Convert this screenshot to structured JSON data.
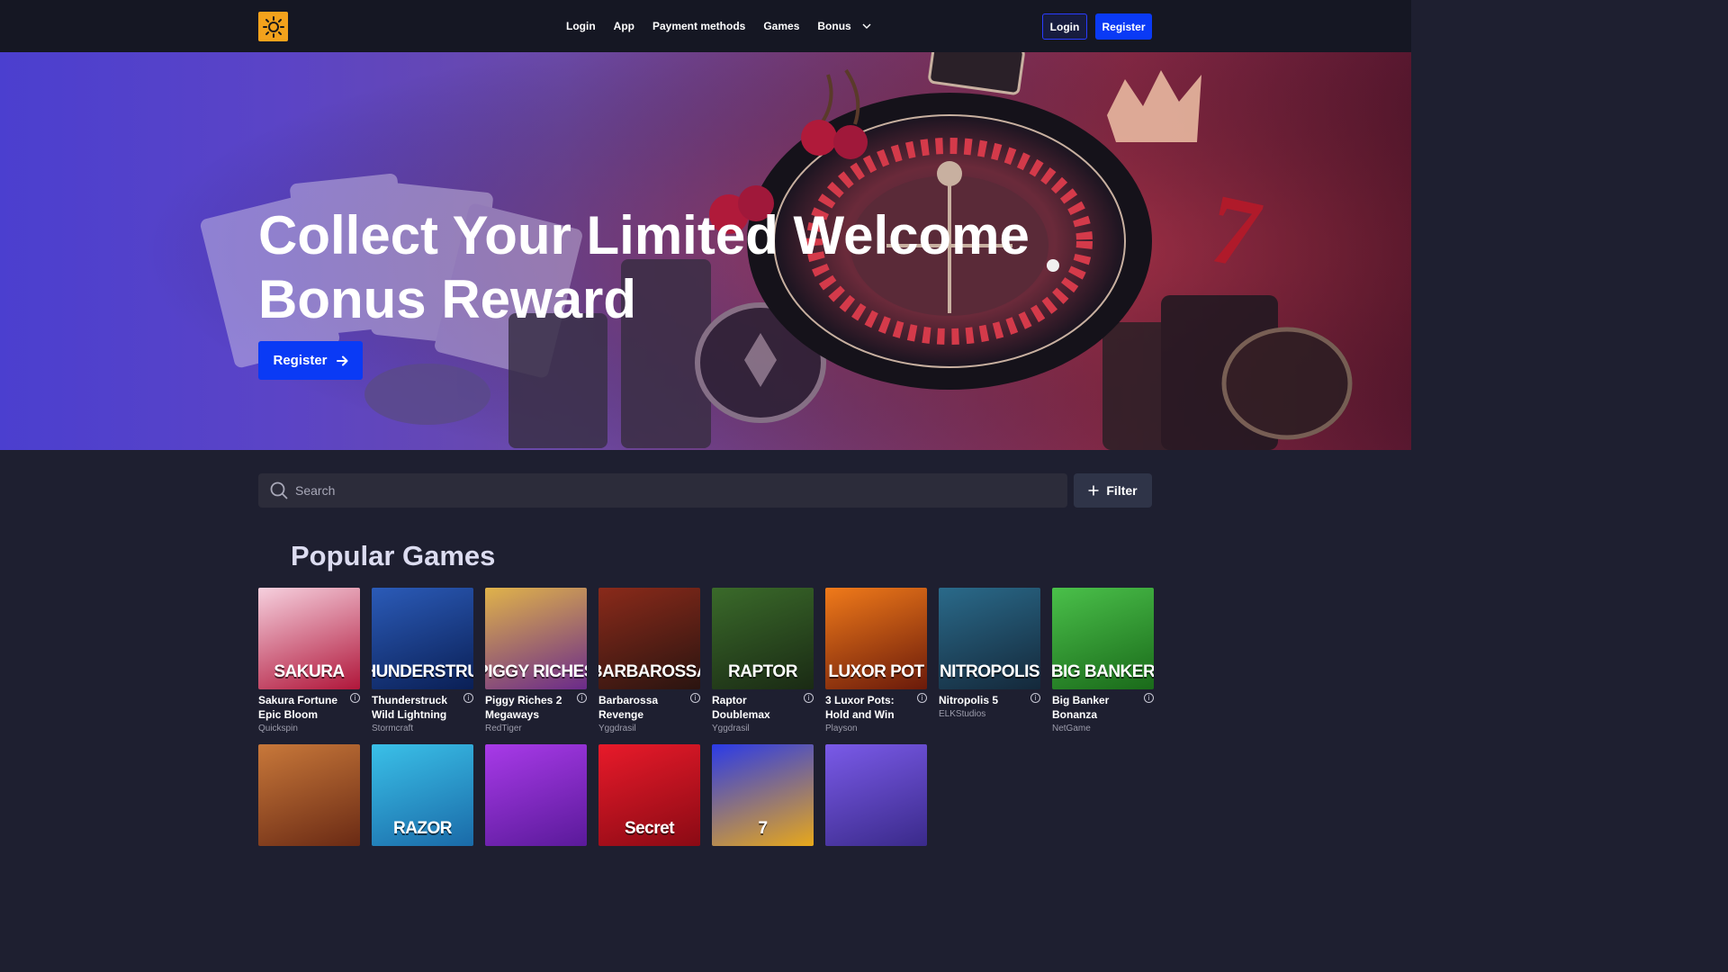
{
  "header": {
    "nav": [
      "Login",
      "App",
      "Payment methods",
      "Games",
      "Bonus"
    ],
    "login_label": "Login",
    "register_label": "Register"
  },
  "hero": {
    "title": "Collect Your Limited Welcome Bonus Reward",
    "cta_label": "Register",
    "cta_icon": "arrow-right-icon"
  },
  "search": {
    "placeholder": "Search",
    "value": ""
  },
  "filter": {
    "label": "Filter",
    "icon": "plus-icon"
  },
  "section_title": "Popular Games",
  "games": [
    {
      "name": "Sakura Fortune Epic Bloom",
      "provider": "Quickspin",
      "art": "SAKURA",
      "c1": "#f6d0de",
      "c2": "#b0163a"
    },
    {
      "name": "Thunderstruck Wild Lightning",
      "provider": "Stormcraft",
      "art": "THUNDERSTRUC",
      "c1": "#2b5bb8",
      "c2": "#0a1f55"
    },
    {
      "name": "Piggy Riches 2 Megaways",
      "provider": "RedTiger",
      "art": "PIGGY RICHES",
      "c1": "#e0b34a",
      "c2": "#6a2a8a"
    },
    {
      "name": "Barbarossa Revenge",
      "provider": "Yggdrasil",
      "art": "BARBAROSSA",
      "c1": "#8a2a1a",
      "c2": "#2a1410"
    },
    {
      "name": "Raptor Doublemax",
      "provider": "Yggdrasil",
      "art": "RAPTOR",
      "c1": "#3a6a2a",
      "c2": "#1a2a14"
    },
    {
      "name": "3 Luxor Pots: Hold and Win",
      "provider": "Playson",
      "art": "LUXOR POT",
      "c1": "#f07a1a",
      "c2": "#6a1a0a"
    },
    {
      "name": "Nitropolis 5",
      "provider": "ELKStudios",
      "art": "NITROPOLIS",
      "c1": "#2a6a8a",
      "c2": "#14283a"
    },
    {
      "name": "Big Banker Bonanza",
      "provider": "NetGame",
      "art": "BIG BANKER",
      "c1": "#4ac04a",
      "c2": "#1a6a1a"
    },
    {
      "name": "",
      "provider": "",
      "art": "",
      "c1": "#c8783a",
      "c2": "#6a2a14"
    },
    {
      "name": "",
      "provider": "",
      "art": "RAZOR",
      "c1": "#3ac0e8",
      "c2": "#1a6aa8"
    },
    {
      "name": "",
      "provider": "",
      "art": "",
      "c1": "#a83ae8",
      "c2": "#5a1a9a"
    },
    {
      "name": "",
      "provider": "",
      "art": "Secret",
      "c1": "#e81a2a",
      "c2": "#8a0a14"
    },
    {
      "name": "",
      "provider": "",
      "art": "7",
      "c1": "#2a3ae8",
      "c2": "#e8a81a"
    },
    {
      "name": "",
      "provider": "",
      "art": "",
      "c1": "#7a5ae8",
      "c2": "#3a2a8a"
    }
  ]
}
